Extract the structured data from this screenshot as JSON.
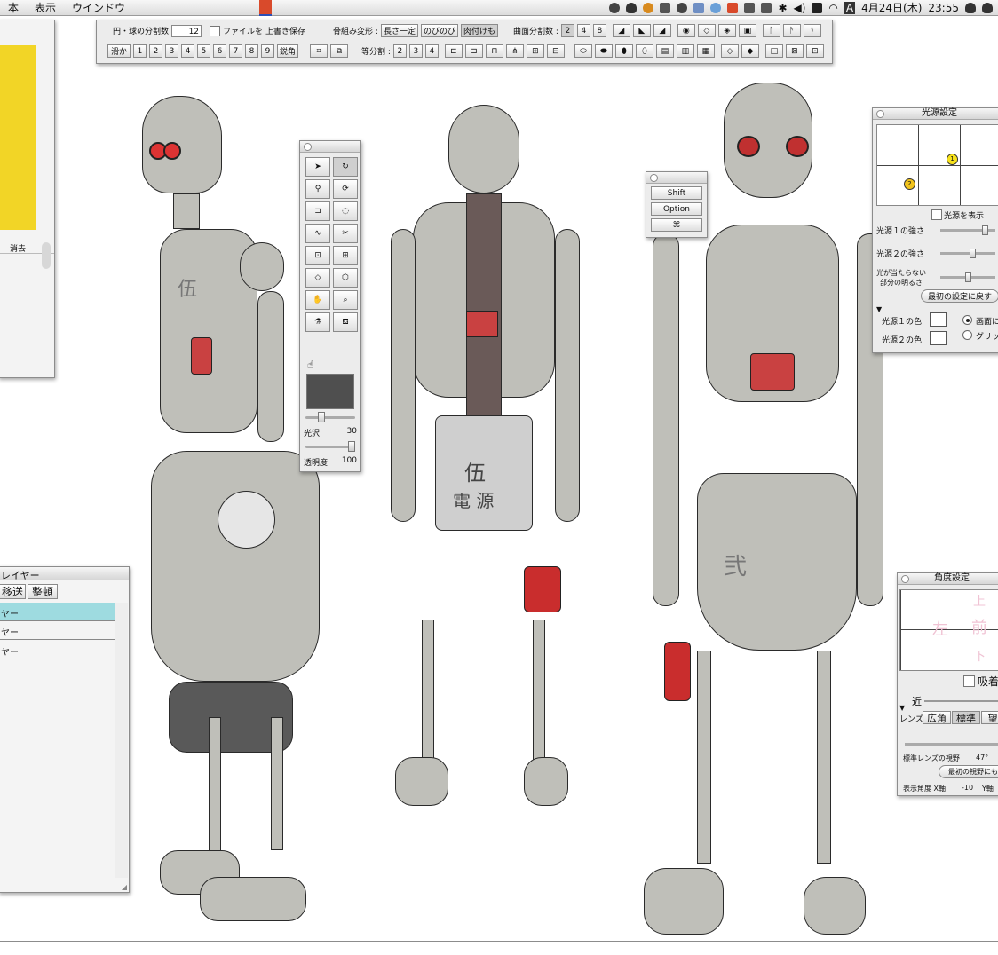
{
  "menubar": {
    "menus": [
      "本",
      "表示",
      "ウインドウ"
    ],
    "date": "4月24日(木)",
    "time": "23:55"
  },
  "top_toolbar": {
    "circle_divisions_label": "円・球の分割数",
    "circle_divisions_value": "12",
    "file_checkbox_label": "ファイルを",
    "overwrite_save_label": "上書き保存",
    "bone_deform_label": "骨組み変形 :",
    "bone_options": [
      "長さ一定",
      "のびのび",
      "肉付けも"
    ],
    "curve_div_label": "曲面分割数 :",
    "curve_div_options": [
      "2",
      "4",
      "8"
    ],
    "smooth_label": "滑か",
    "angle_numbers": [
      "1",
      "2",
      "3",
      "4",
      "5",
      "6",
      "7",
      "8",
      "9"
    ],
    "sharp_label": "鋭角",
    "equal_div_label": "等分割 :",
    "equal_div_options": [
      "2",
      "3",
      "4"
    ]
  },
  "tools_palette": {
    "gloss_label": "光沢",
    "gloss_value": "30",
    "gloss_level": 0.3,
    "opacity_label": "透明度",
    "opacity_value": "100",
    "opacity_level": 1.0,
    "swatch_color": "#4f4f4f"
  },
  "modifier_palette": {
    "shift": "Shift",
    "option": "Option",
    "cmd": "⌘"
  },
  "left_panel": {
    "delete_label": "消去",
    "swatch_color": "#f2d526"
  },
  "layer_panel": {
    "title": "レイヤー",
    "move_label": "移送",
    "arrange_label": "整頓",
    "rows": [
      "ヤー",
      "ヤー",
      "ヤー"
    ],
    "active_color": "#9edbe0"
  },
  "light_panel": {
    "title": "光源設定",
    "show_label": "光源を表示",
    "light1_strength": "光源１の強さ",
    "light2_strength": "光源２の強さ",
    "unlit_label": "光が当たらない",
    "unlit_label2": "部分の明るさ",
    "reset_label": "最初の設定に戻す",
    "light1_color": "光源１の色",
    "light2_color": "光源２の色",
    "radio_screen": "画面に",
    "radio_grid": "グリッ",
    "marker1": "1",
    "marker2": "2",
    "light1_strength_level": 0.85,
    "light2_strength_level": 0.6,
    "unlit_level": 0.5
  },
  "angle_panel": {
    "title": "角度設定",
    "snap_label": "吸着",
    "near_label": "近",
    "lens_label": "レンズ",
    "wide_label": "広角",
    "standard_label": "標準",
    "tele_label": "望",
    "fov_label": "標準レンズの視野",
    "fov_value": "47°",
    "reset_view_label": "最初の視野にも",
    "display_angle": "表示角度 X軸",
    "x_value": "-10",
    "y_label": "Y軸",
    "watermark_left": "左",
    "watermark_front": "前",
    "watermark_up": "上",
    "watermark_down": "下"
  },
  "figures": {
    "chest_kanji_left": "伍",
    "chest_kanji_center": "伍",
    "belly_kanji_center": "電 源",
    "hip_kanji_right": "弐"
  }
}
